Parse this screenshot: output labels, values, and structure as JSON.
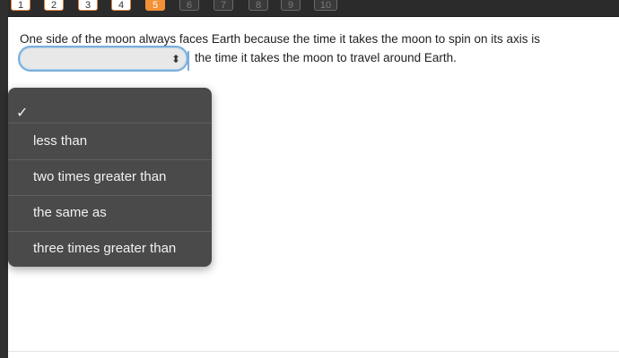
{
  "nav": {
    "questions": [
      "1",
      "2",
      "3",
      "4",
      "5",
      "6",
      "7",
      "8",
      "9",
      "10"
    ],
    "active_index": 4
  },
  "question": {
    "part1": "One side of the moon always faces Earth because the time it takes the moon to spin on its axis is",
    "part2": "the time it takes the moon to travel around Earth."
  },
  "select": {
    "value": "",
    "arrow_icon": "⬍"
  },
  "dropdown": {
    "check_icon": "✓",
    "options": [
      "",
      "less than",
      "two times greater than",
      "the same as",
      "three times greater than"
    ]
  },
  "colors": {
    "active": "#f39137",
    "focus_ring": "#7aaedc",
    "menu_bg": "#4a4a4a"
  }
}
